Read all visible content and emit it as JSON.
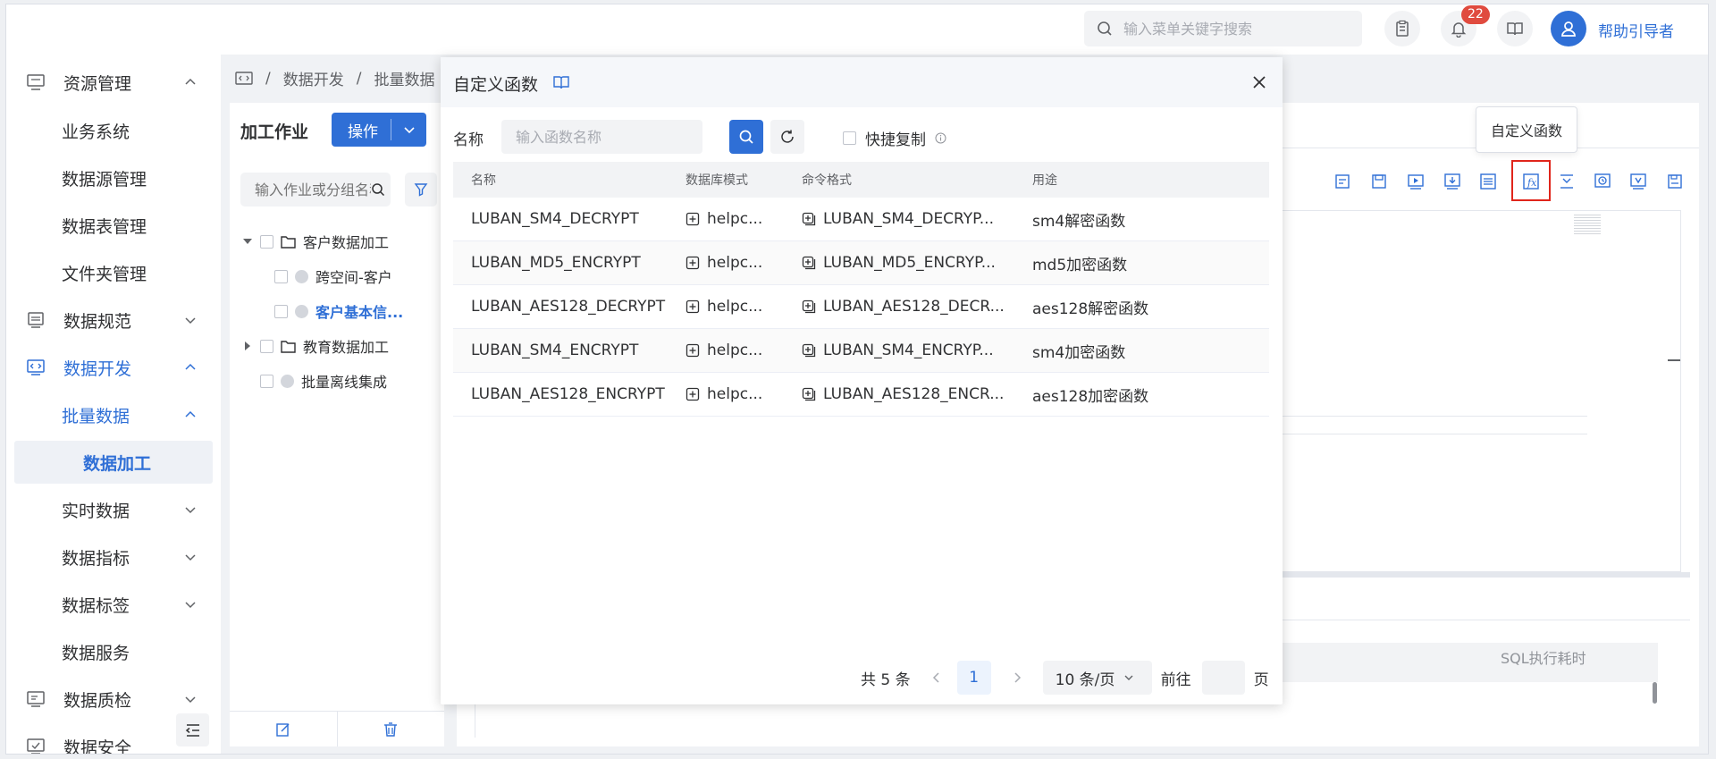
{
  "header": {
    "search_placeholder": "输入菜单关键字搜索",
    "notification_count": "22",
    "username": "帮助引导者"
  },
  "sidebar": {
    "items": [
      {
        "label": "资源管理",
        "icon": "server-icon",
        "expanded": true
      },
      {
        "label": "业务系统"
      },
      {
        "label": "数据源管理"
      },
      {
        "label": "数据表管理"
      },
      {
        "label": "文件夹管理"
      },
      {
        "label": "数据规范",
        "icon": "database-icon",
        "expanded": false
      },
      {
        "label": "数据开发",
        "icon": "code-icon",
        "expanded": true
      },
      {
        "label": "批量数据",
        "expanded": true
      },
      {
        "label": "数据加工",
        "selected": true
      },
      {
        "label": "实时数据",
        "expanded": false
      },
      {
        "label": "数据指标",
        "expanded": false
      },
      {
        "label": "数据标签",
        "expanded": false
      },
      {
        "label": "数据服务"
      },
      {
        "label": "数据质检",
        "icon": "quality-icon",
        "expanded": false
      },
      {
        "label": "数据安全",
        "icon": "security-icon"
      }
    ]
  },
  "breadcrumb": [
    "数据开发",
    "批量数据"
  ],
  "job_panel": {
    "title": "加工作业",
    "op_button": "操作",
    "search_placeholder": "输入作业或分组名称",
    "tree": [
      {
        "label": "客户数据加工",
        "type": "folder",
        "expanded": true
      },
      {
        "label": "跨空间-客户",
        "type": "job"
      },
      {
        "label": "客户基本信...",
        "type": "job",
        "active": true
      },
      {
        "label": "教育数据加工",
        "type": "folder",
        "expanded": false
      },
      {
        "label": "批量离线集成",
        "type": "job"
      }
    ]
  },
  "editor": {
    "tooltip": "自定义函数",
    "result_col": "SQL执行耗时"
  },
  "modal": {
    "title": "自定义函数",
    "name_label": "名称",
    "name_placeholder": "输入函数名称",
    "quick_copy": "快捷复制",
    "columns": [
      "名称",
      "数据库模式",
      "命令格式",
      "用途"
    ],
    "rows": [
      {
        "name": "LUBAN_SM4_DECRYPT",
        "schema": "helpc...",
        "cmd": "LUBAN_SM4_DECRYP...",
        "usage": "sm4解密函数"
      },
      {
        "name": "LUBAN_MD5_ENCRYPT",
        "schema": "helpc...",
        "cmd": "LUBAN_MD5_ENCRYP...",
        "usage": "md5加密函数"
      },
      {
        "name": "LUBAN_AES128_DECRYPT",
        "schema": "helpc...",
        "cmd": "LUBAN_AES128_DECR...",
        "usage": "aes128解密函数"
      },
      {
        "name": "LUBAN_SM4_ENCRYPT",
        "schema": "helpc...",
        "cmd": "LUBAN_SM4_ENCRYP...",
        "usage": "sm4加密函数"
      },
      {
        "name": "LUBAN_AES128_ENCRYPT",
        "schema": "helpc...",
        "cmd": "LUBAN_AES128_ENCR...",
        "usage": "aes128加密函数"
      }
    ],
    "pager": {
      "total": "共 5 条",
      "current_page": "1",
      "page_size": "10 条/页",
      "goto_label": "前往",
      "page_suffix": "页"
    }
  },
  "colors": {
    "primary": "#2f6fd6",
    "badge": "#e04b3f",
    "highlight_box": "#e0251b"
  }
}
